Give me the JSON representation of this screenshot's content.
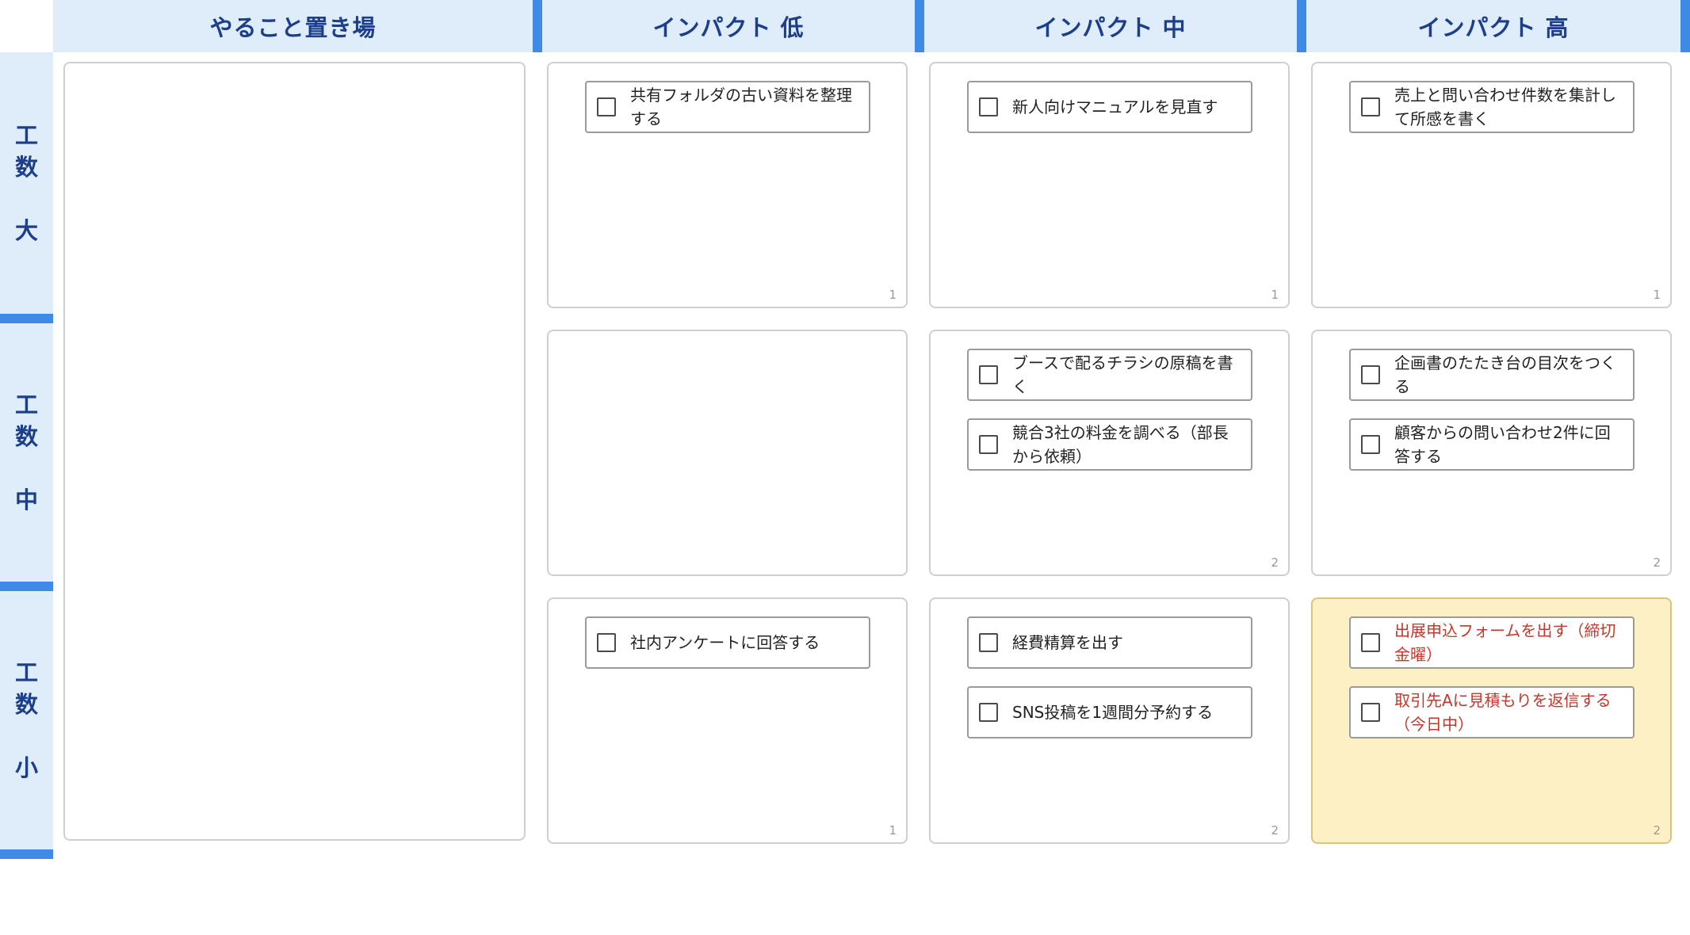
{
  "columns": {
    "backlog": "やること置き場",
    "low": "インパクト 低",
    "mid": "インパクト 中",
    "high": "インパクト 高"
  },
  "rows": {
    "large": [
      "工",
      "数",
      "大"
    ],
    "medium": [
      "工",
      "数",
      "中"
    ],
    "small": [
      "工",
      "数",
      "小"
    ]
  },
  "cells": {
    "large_low": {
      "count": "1",
      "tasks": [
        "共有フォルダの古い資料を整理する"
      ]
    },
    "large_mid": {
      "count": "1",
      "tasks": [
        "新人向けマニュアルを見直す"
      ]
    },
    "large_high": {
      "count": "1",
      "tasks": [
        "売上と問い合わせ件数を集計して所感を書く"
      ]
    },
    "medium_low": {
      "count": "",
      "tasks": []
    },
    "medium_mid": {
      "count": "2",
      "tasks": [
        "ブースで配るチラシの原稿を書く",
        "競合3社の料金を調べる（部長から依頼）"
      ]
    },
    "medium_high": {
      "count": "2",
      "tasks": [
        "企画書のたたき台の目次をつくる",
        "顧客からの問い合わせ2件に回答する"
      ]
    },
    "small_low": {
      "count": "1",
      "tasks": [
        "社内アンケートに回答する"
      ]
    },
    "small_mid": {
      "count": "2",
      "tasks": [
        "経費精算を出す",
        "SNS投稿を1週間分予約する"
      ]
    },
    "small_high": {
      "count": "2",
      "tasks": [
        "出展申込フォームを出す（締切 金曜）",
        "取引先Aに見積もりを返信する（今日中）"
      ]
    }
  },
  "colors": {
    "header_bg": "#dfedfb",
    "header_text": "#1d3f8a",
    "accent": "#3f8ae6",
    "highlight_bg": "#fdf0c4",
    "urgent_text": "#c0392b"
  }
}
